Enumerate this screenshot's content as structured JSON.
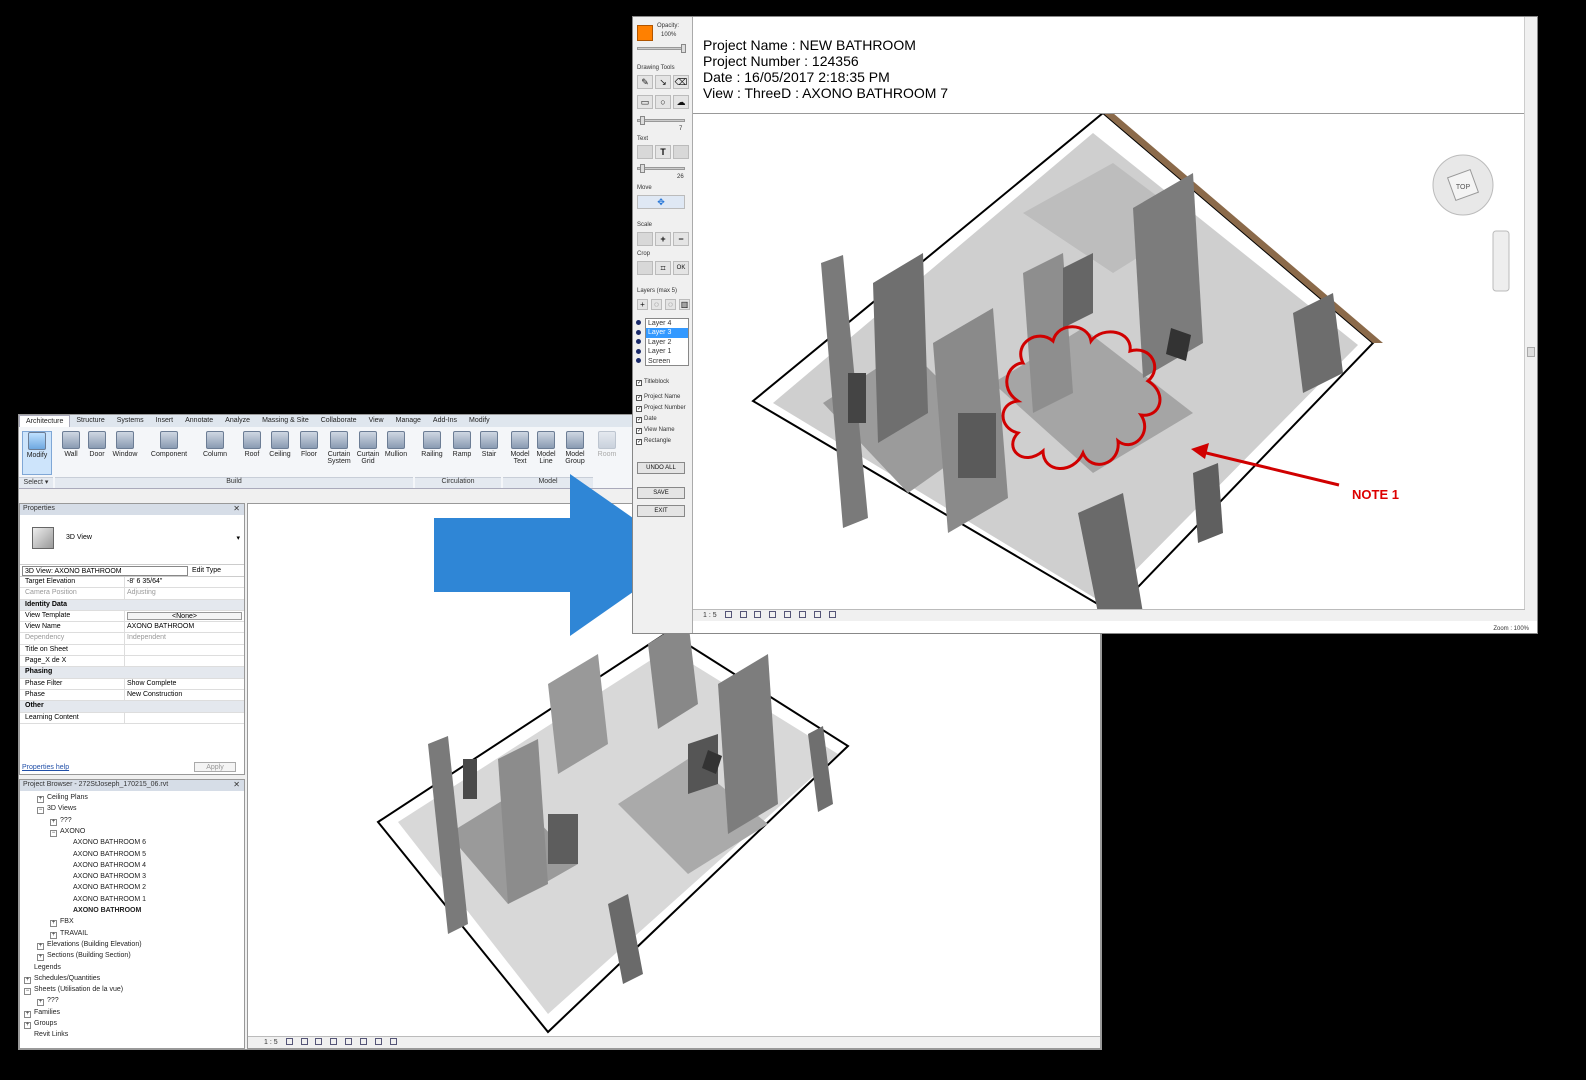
{
  "ribbon": {
    "tabs": [
      "Architecture",
      "Structure",
      "Systems",
      "Insert",
      "Annotate",
      "Analyze",
      "Massing & Site",
      "Collaborate",
      "View",
      "Manage",
      "Add-Ins",
      "Modify"
    ],
    "tools": {
      "modify": "Modify",
      "wall": "Wall",
      "door": "Door",
      "window": "Window",
      "component": "Component",
      "column": "Column",
      "roof": "Roof",
      "ceiling": "Ceiling",
      "floor": "Floor",
      "curtain_system": "Curtain System",
      "curtain_grid": "Curtain Grid",
      "mullion": "Mullion",
      "railing": "Railing",
      "ramp": "Ramp",
      "stair": "Stair",
      "model_text": "Model Text",
      "model_line": "Model Line",
      "model_group": "Model Group",
      "room": "Room"
    },
    "groups": {
      "select": "Select ▾",
      "build": "Build",
      "circulation": "Circulation",
      "model": "Model"
    }
  },
  "properties": {
    "title": "Properties",
    "type_name": "3D View",
    "instance_filter": "3D View: AXONO BATHROOM",
    "edit_type": "Edit Type",
    "rows": [
      {
        "k": "Target Elevation",
        "v": "-8'  6 35/64\"",
        "kind": "normal"
      },
      {
        "k": "Camera Position",
        "v": "Adjusting",
        "kind": "grey"
      },
      {
        "k": "Identity Data",
        "v": "",
        "kind": "group"
      },
      {
        "k": "View Template",
        "v": "<None>",
        "kind": "button"
      },
      {
        "k": "View Name",
        "v": "AXONO BATHROOM",
        "kind": "normal"
      },
      {
        "k": "Dependency",
        "v": "Independent",
        "kind": "grey"
      },
      {
        "k": "Title on Sheet",
        "v": "",
        "kind": "normal"
      },
      {
        "k": "Page_X de X",
        "v": "",
        "kind": "normal"
      },
      {
        "k": "Phasing",
        "v": "",
        "kind": "group"
      },
      {
        "k": "Phase Filter",
        "v": "Show Complete",
        "kind": "normal"
      },
      {
        "k": "Phase",
        "v": "New Construction",
        "kind": "normal"
      },
      {
        "k": "Other",
        "v": "",
        "kind": "group"
      },
      {
        "k": "Learning Content",
        "v": "",
        "kind": "normal"
      }
    ],
    "help_link": "Properties help",
    "apply": "Apply"
  },
  "project_browser": {
    "title": "Project Browser - 272StJoseph_170215_06.rvt",
    "nodes": [
      {
        "label": "Ceiling Plans",
        "depth": 1,
        "pm": "+"
      },
      {
        "label": "3D Views",
        "depth": 1,
        "pm": "−"
      },
      {
        "label": "???",
        "depth": 2,
        "pm": "+"
      },
      {
        "label": "AXONO",
        "depth": 2,
        "pm": "−"
      },
      {
        "label": "AXONO BATHROOM 6",
        "depth": 3,
        "pm": ""
      },
      {
        "label": "AXONO BATHROOM 5",
        "depth": 3,
        "pm": ""
      },
      {
        "label": "AXONO BATHROOM 4",
        "depth": 3,
        "pm": ""
      },
      {
        "label": "AXONO BATHROOM 3",
        "depth": 3,
        "pm": ""
      },
      {
        "label": "AXONO BATHROOM 2",
        "depth": 3,
        "pm": ""
      },
      {
        "label": "AXONO BATHROOM 1",
        "depth": 3,
        "pm": ""
      },
      {
        "label": "AXONO BATHROOM",
        "depth": 3,
        "pm": "",
        "bold": true
      },
      {
        "label": "FBX",
        "depth": 2,
        "pm": "+"
      },
      {
        "label": "TRAVAIL",
        "depth": 2,
        "pm": "+"
      },
      {
        "label": "Elevations (Building Elevation)",
        "depth": 1,
        "pm": "+"
      },
      {
        "label": "Sections (Building Section)",
        "depth": 1,
        "pm": "+"
      },
      {
        "label": "Legends",
        "depth": 0,
        "pm": ""
      },
      {
        "label": "Schedules/Quantities",
        "depth": 0,
        "pm": "+"
      },
      {
        "label": "Sheets (Utilisation de la vue)",
        "depth": 0,
        "pm": "−"
      },
      {
        "label": "???",
        "depth": 1,
        "pm": "+"
      },
      {
        "label": "Families",
        "depth": 0,
        "pm": "+"
      },
      {
        "label": "Groups",
        "depth": 0,
        "pm": "+"
      },
      {
        "label": "Revit Links",
        "depth": 0,
        "pm": ""
      }
    ]
  },
  "revit_status": {
    "scale": "1 : 5"
  },
  "markup": {
    "opacity_label": "Opacity:",
    "opacity_value": "100%",
    "drawing_tools": "Drawing Tools",
    "pen_size": "7",
    "text_label": "Text",
    "text_size": "26",
    "move_label": "Move",
    "scale_label": "Scale",
    "crop_label": "Crop",
    "ok": "OK",
    "layers_label": "Layers  (max 5)",
    "layers": [
      "Layer 4",
      "Layer 3",
      "Layer 2",
      "Layer 1",
      "Screen"
    ],
    "selected_layer": "Layer 3",
    "titleblock": "Titleblock",
    "fields": [
      "Project Name",
      "Project Number",
      "Date",
      "View Name",
      "Rectangle"
    ],
    "undo_all": "UNDO ALL",
    "save": "SAVE",
    "exit": "EXIT",
    "project_name": "Project Name : NEW BATHROOM",
    "project_number": "Project Number : 124356",
    "date": "Date : 16/05/2017 2:18:35 PM",
    "view": "View : ThreeD : AXONO BATHROOM 7",
    "note": "NOTE 1",
    "scale": "1 : 5",
    "zoom": "Zoom : 100%",
    "viewcube_label": "TOP"
  },
  "colors": {
    "accent_orange": "#ff8000",
    "markup_red": "#d00000",
    "arrow_blue": "#2f86d6"
  }
}
